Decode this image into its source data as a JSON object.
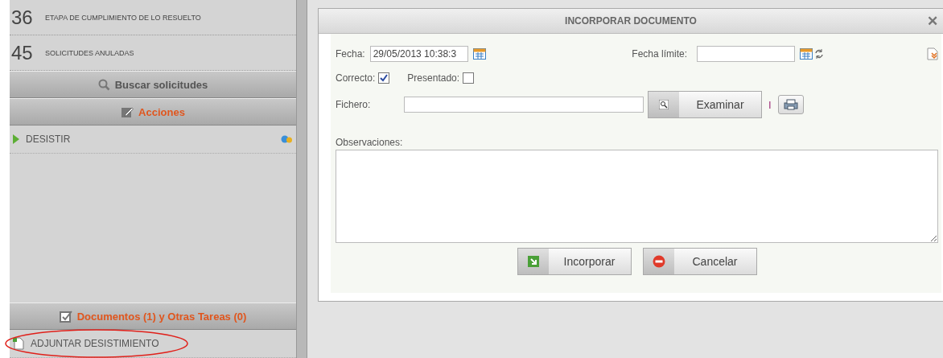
{
  "sidebar": {
    "counters": [
      {
        "count": "36",
        "label": "ETAPA DE CUMPLIMIENTO DE LO RESUELTO"
      },
      {
        "count": "45",
        "label": "SOLICITUDES ANULADAS"
      }
    ],
    "sections": [
      {
        "kind": "search",
        "title": "Buscar solicitudes"
      },
      {
        "kind": "actions",
        "title": "Acciones",
        "items": [
          {
            "label": "DESISTIR"
          }
        ]
      },
      {
        "kind": "documents",
        "title": "Documentos (1) y Otras Tareas (0)",
        "items": [
          {
            "label": "ADJUNTAR DESISTIMIENTO",
            "highlighted": true
          }
        ]
      }
    ]
  },
  "dialog": {
    "title": "INCORPORAR DOCUMENTO",
    "close": "✕",
    "fecha": {
      "label": "Fecha:",
      "value": "29/05/2013 10:38:3"
    },
    "fecha_limite": {
      "label": "Fecha límite:"
    },
    "checks": [
      {
        "label": "Correcto:",
        "checked": true
      },
      {
        "label": "Presentado:",
        "checked": false
      }
    ],
    "fichero": {
      "label": "Fichero:",
      "button": "Examinar",
      "separator": "I"
    },
    "observaciones": {
      "label": "Observaciones:"
    },
    "buttons": [
      {
        "kind": "ok",
        "label": "Incorporar"
      },
      {
        "kind": "cancel",
        "label": "Cancelar"
      }
    ]
  }
}
